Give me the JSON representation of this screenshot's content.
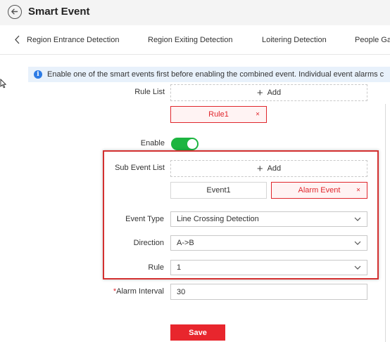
{
  "header": {
    "title": "Smart Event",
    "back_icon": "back-arrow-circle-icon"
  },
  "tabs": [
    {
      "label": "Region Entrance Detection"
    },
    {
      "label": "Region Exiting Detection"
    },
    {
      "label": "Loitering Detection"
    },
    {
      "label": "People Ga"
    }
  ],
  "banner": {
    "icon": "info-icon",
    "icon_glyph": "i",
    "text": "Enable one of the smart events first before enabling the combined event. Individual event alarms c"
  },
  "form": {
    "rule_list_label": "Rule List",
    "add_label": "Add",
    "rule_chip": "Rule1",
    "enable_label": "Enable",
    "enable_on": true,
    "sub_event_list_label": "Sub Event List",
    "sub_add_label": "Add",
    "sub_event_1": "Event1",
    "sub_event_2": "Alarm Event",
    "event_type_label": "Event Type",
    "event_type_value": "Line Crossing Detection",
    "direction_label": "Direction",
    "direction_value": "A->B",
    "rule_label": "Rule",
    "rule_value": "1",
    "alarm_interval_required_mark": "*",
    "alarm_interval_label": "Alarm Interval",
    "alarm_interval_value": "30",
    "save_label": "Save",
    "close_glyph": "×"
  },
  "colors": {
    "accent": "#e8262d",
    "toggle_on": "#1cb540",
    "info": "#2d7be5",
    "highlight_border": "#d33030"
  }
}
